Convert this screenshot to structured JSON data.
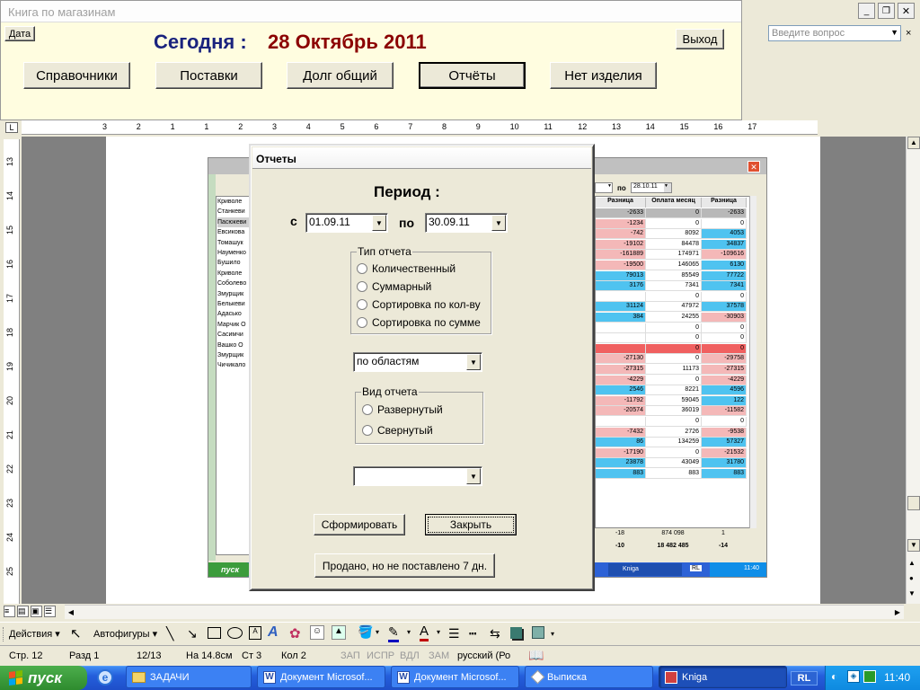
{
  "word": {
    "help_placeholder": "Введите вопрос",
    "ruler_numbers": [
      "3",
      "2",
      "1",
      "1",
      "2",
      "3",
      "4",
      "5",
      "6",
      "7",
      "8",
      "9",
      "10",
      "11",
      "12",
      "13",
      "14",
      "15",
      "16",
      "17"
    ],
    "vruler_numbers": [
      "13",
      "14",
      "15",
      "16",
      "17",
      "18",
      "19",
      "20",
      "21",
      "22",
      "23",
      "24",
      "25"
    ],
    "drawing_toolbar": {
      "actions": "Действия",
      "autoshapes": "Автофигуры"
    },
    "status": {
      "page": "Стр. 12",
      "section": "Разд 1",
      "pages": "12/13",
      "at": "На 14.8см",
      "line": "Ст 3",
      "col": "Кол 2",
      "rec": "ЗАП",
      "trk": "ИСПР",
      "ext": "ВДЛ",
      "ovr": "ЗАМ",
      "lang": "русский (Ро"
    }
  },
  "app": {
    "title": "Книга по магазинам",
    "date_button": "Дата",
    "today_label": "Сегодня :",
    "today_date": "28 Октябрь 2011",
    "exit_button": "Выход",
    "nav": [
      {
        "label": "Справочники"
      },
      {
        "label": "Поставки"
      },
      {
        "label": "Долг общий"
      },
      {
        "label": "Отчёты"
      },
      {
        "label": "Нет изделия"
      }
    ]
  },
  "embedded": {
    "to_label": "по",
    "date_to": "28.10.11",
    "col_headers": [
      "Разница",
      "Оплата месяц",
      "Разница"
    ],
    "names": [
      "Криволе",
      "Станкеви",
      "Пасюкеви",
      "Евсикова",
      "Томашук",
      "Науменко",
      "Бушило",
      "Криволе",
      "Соболево",
      "Змурщик",
      "Белькеви",
      "Адасько",
      "Марчик О",
      "Сасимчи",
      "Вашко О",
      "Змурщик",
      "Чичикало"
    ],
    "rows": [
      [
        "-2633",
        "0",
        "-2633"
      ],
      [
        "-1234",
        "0",
        "0"
      ],
      [
        "-742",
        "8092",
        "4053"
      ],
      [
        "-19102",
        "84478",
        "34837"
      ],
      [
        "-161889",
        "174971",
        "-109616"
      ],
      [
        "-19500",
        "146065",
        "6130"
      ],
      [
        "79013",
        "85549",
        "77722"
      ],
      [
        "3176",
        "7341",
        "7341"
      ],
      [
        "",
        "0",
        "0"
      ],
      [
        "31124",
        "47972",
        "37578"
      ],
      [
        "384",
        "24255",
        "-30903"
      ],
      [
        "",
        "0",
        "0"
      ],
      [
        "",
        "0",
        "0"
      ],
      [
        "",
        "0",
        "0"
      ],
      [
        "-27130",
        "0",
        "-29758"
      ],
      [
        "-27315",
        "11173",
        "-27315"
      ],
      [
        "-4229",
        "0",
        "-4229"
      ],
      [
        "2546",
        "8221",
        "4596"
      ],
      [
        "-11792",
        "59045",
        "122"
      ],
      [
        "-20574",
        "36019",
        "-11582"
      ],
      [
        "",
        "0",
        "0"
      ],
      [
        "-7432",
        "2726",
        "-9538"
      ],
      [
        "86",
        "134259",
        "57327"
      ],
      [
        "-17190",
        "0",
        "-21532"
      ],
      [
        "23878",
        "43049",
        "31780"
      ],
      [
        "883",
        "883",
        "883"
      ]
    ],
    "totals1": [
      "-18",
      "874 098",
      "1"
    ],
    "totals2": [
      "-10",
      "18 482 485",
      "-14"
    ],
    "task_label": "Kniga",
    "lang": "RL",
    "clock": "11:40",
    "start": "пуск"
  },
  "dialog": {
    "title": "Отчеты",
    "period_label": "Период :",
    "from_label": "с",
    "from_date": "01.09.11",
    "to_label": "по",
    "to_date": "30.09.11",
    "report_type_legend": "Тип отчета",
    "report_types": [
      "Количественный",
      "Суммарный",
      "Сортировка по кол-ву",
      "Сортировка по сумме"
    ],
    "region_select": "по областям",
    "view_legend": "Вид отчета",
    "views": [
      "Развернутый",
      "Свернутый"
    ],
    "empty_select": "",
    "generate_button": "Сформировать",
    "close_button": "Закрыть",
    "sold_button": "Продано, но не поставлено 7 дн."
  },
  "taskbar": {
    "start": "пуск",
    "tasks": [
      {
        "label": "ЗАДАЧИ"
      },
      {
        "label": "Документ Microsof..."
      },
      {
        "label": "Документ Microsof..."
      },
      {
        "label": "Выписка"
      },
      {
        "label": "Kniga"
      }
    ],
    "lang": "RL",
    "clock": "11:40"
  },
  "colors": {
    "pink": "#f4b8b8",
    "cyan": "#4fc3f0",
    "red": "#f06060",
    "today_label": "#1a237e",
    "today_date": "#8b0000"
  }
}
